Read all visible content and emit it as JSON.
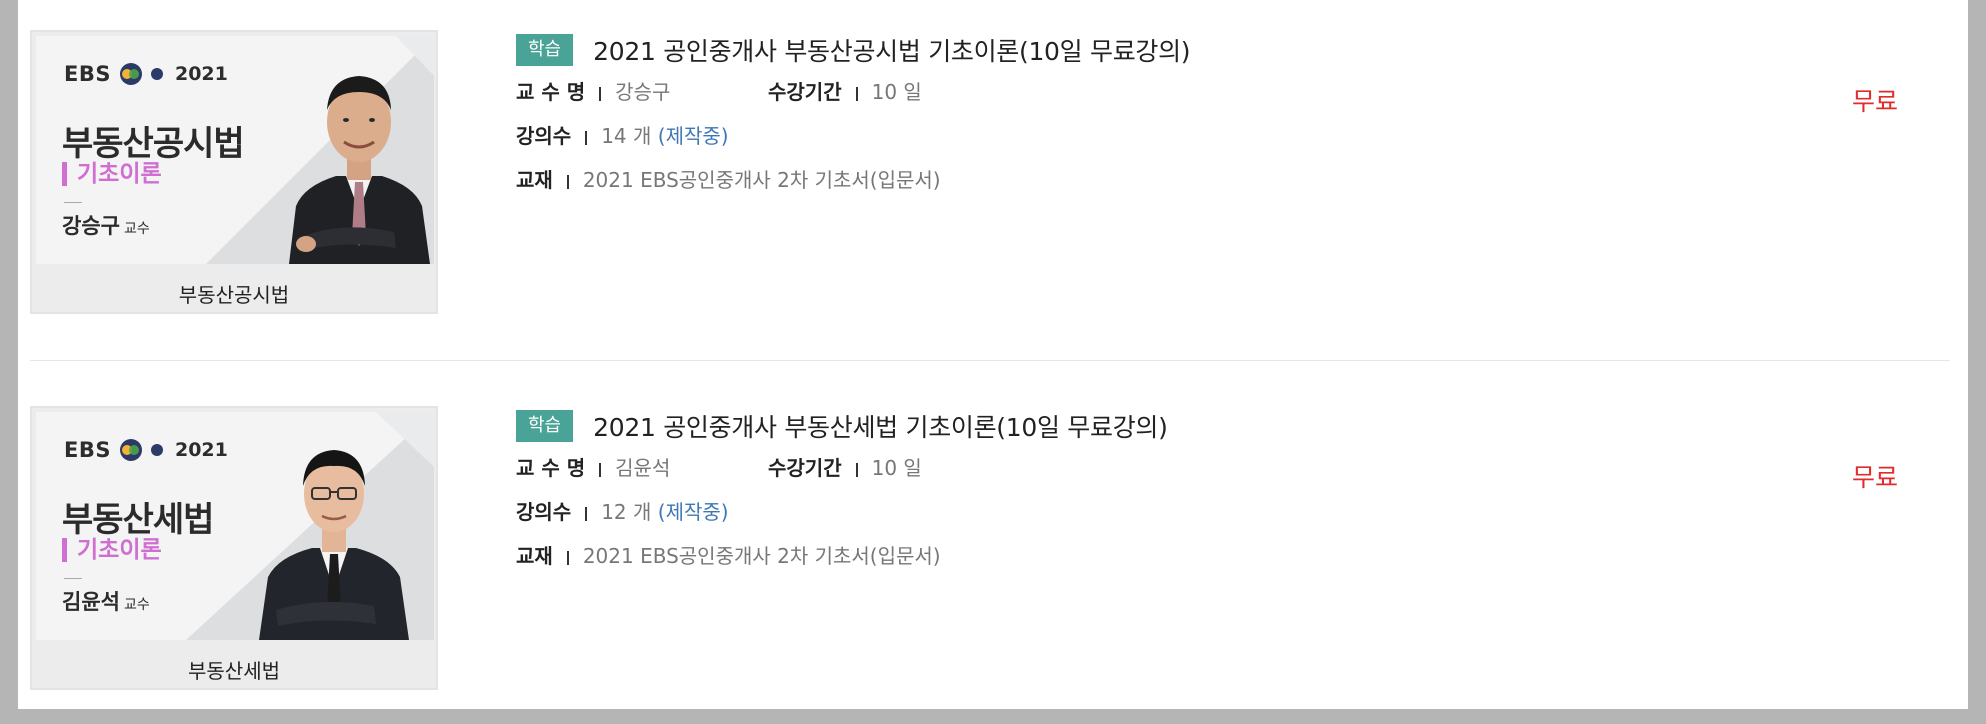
{
  "courses": [
    {
      "thumb": {
        "ebs": "EBS",
        "year": "2021",
        "subject": "부동산공시법",
        "sub": "기초이론",
        "professor": "강승구",
        "prof_suffix": "교수",
        "caption": "부동산공시법"
      },
      "badge": "학습",
      "title": "2021 공인중개사 부동산공시법 기초이론(10일 무료강의)",
      "professor_label": "교 수 명",
      "professor": "강승구",
      "period_label": "수강기간",
      "period": "10 일",
      "lectures_label": "강의수",
      "lectures": "14 개",
      "lectures_status": "(제작중)",
      "textbook_label": "교재",
      "textbook": "2021 EBS공인중개사 2차 기초서(입문서)",
      "price": "무료"
    },
    {
      "thumb": {
        "ebs": "EBS",
        "year": "2021",
        "subject": "부동산세법",
        "sub": "기초이론",
        "professor": "김윤석",
        "prof_suffix": "교수",
        "caption": "부동산세법"
      },
      "badge": "학습",
      "title": "2021 공인중개사 부동산세법 기초이론(10일 무료강의)",
      "professor_label": "교 수 명",
      "professor": "김윤석",
      "period_label": "수강기간",
      "period": "10 일",
      "lectures_label": "강의수",
      "lectures": "12 개",
      "lectures_status": "(제작중)",
      "textbook_label": "교재",
      "textbook": "2021 EBS공인중개사 2차 기초서(입문서)",
      "price": "무료"
    }
  ],
  "colors": {
    "badge": "#4aa397",
    "price": "#e22b2b",
    "status_blue": "#3e77b6",
    "thumb_accent": "#d06ed2"
  },
  "icons": [
    "ebs-logo-icon",
    "professor-photo"
  ]
}
